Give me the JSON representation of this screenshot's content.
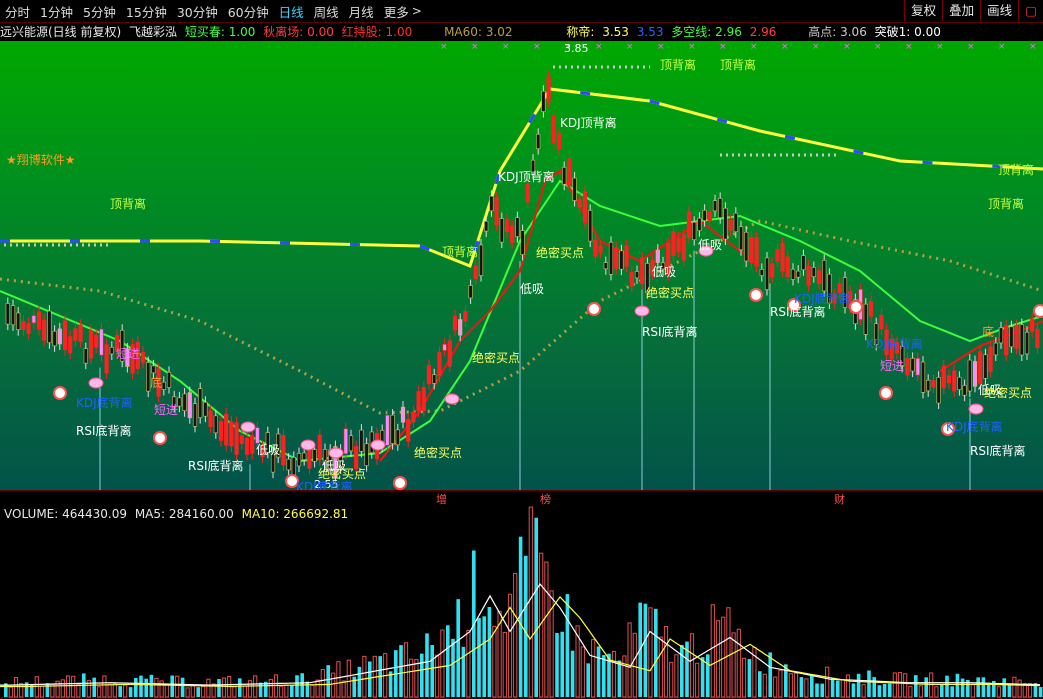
{
  "toolbar": {
    "periods": [
      "分时",
      "1分钟",
      "5分钟",
      "15分钟",
      "30分钟",
      "60分钟",
      "日线",
      "周线",
      "月线",
      "更多"
    ],
    "active_period": "日线",
    "buttons": [
      "复权",
      "叠加",
      "画线"
    ]
  },
  "info_bar": {
    "stock_title": "远兴能源(日线 前复权)",
    "indicator_name": "飞越彩泓",
    "short_buy": "短买春: 1.00",
    "autumn": "秋离场: 0.00",
    "red_hold": "红持股: 1.00",
    "ma60": "MA60: 3.02",
    "chengdi_label": "称帝:",
    "chengdi_value1": "3.53",
    "chengdi_value2": "3.53",
    "duokong": "多空线: 2.96",
    "duokong_value2": "2.96",
    "high_point": "高点: 3.06",
    "breakthrough": "突破1: 0.00"
  },
  "colors": {
    "up_candle": "#ff2020",
    "down_candle": "#00ffff",
    "ma_yellow": "#ffff40",
    "ma_blue": "#2a4cff",
    "green_line": "#3cff3c",
    "red_line": "#ff1010",
    "dotted_line": "#b8a040",
    "pink_candle": "#ff88ff",
    "label_white": "#ffffff",
    "label_yellow": "#ffff60",
    "label_pink": "#ff66ff",
    "label_blue": "#2060ff",
    "label_orange": "#ff9922",
    "volume_red": "#e05050",
    "volume_cyan": "#30e0f0"
  },
  "main_chart": {
    "price_peak_label": "3.85",
    "price_low_label": "2.55",
    "watermark": "★翔博软件★",
    "annotations": [
      {
        "text": "顶背离",
        "color": "yellow-green"
      },
      {
        "text": "顶背离",
        "color": "yellow-green"
      },
      {
        "text": "顶背离",
        "color": "yellow-green"
      },
      {
        "text": "顶背离",
        "color": "yellow-green"
      },
      {
        "text": "顶背离",
        "color": "yellow-green"
      },
      {
        "text": "顶背离",
        "color": "yellow-green"
      },
      {
        "text": "KDJ顶背离",
        "color": "white"
      },
      {
        "text": "KDJ顶背离",
        "color": "white"
      },
      {
        "text": "低吸",
        "color": "white"
      },
      {
        "text": "低吸",
        "color": "white"
      },
      {
        "text": "低吸",
        "color": "white"
      },
      {
        "text": "低吸",
        "color": "white"
      },
      {
        "text": "低吸",
        "color": "white"
      },
      {
        "text": "低吸",
        "color": "white"
      },
      {
        "text": "绝密买点",
        "color": "yellow"
      },
      {
        "text": "绝密买点",
        "color": "yellow"
      },
      {
        "text": "绝密买点",
        "color": "yellow"
      },
      {
        "text": "绝密买点",
        "color": "yellow"
      },
      {
        "text": "绝密买点",
        "color": "yellow"
      },
      {
        "text": "绝密买点",
        "color": "yellow"
      },
      {
        "text": "RSI底背离",
        "color": "white"
      },
      {
        "text": "RSI底背离",
        "color": "white"
      },
      {
        "text": "RSI底背离",
        "color": "white"
      },
      {
        "text": "RSI底背离",
        "color": "white"
      },
      {
        "text": "RSI底背离",
        "color": "white"
      },
      {
        "text": "KDJ底背离",
        "color": "blue"
      },
      {
        "text": "KDJ底背离",
        "color": "blue"
      },
      {
        "text": "KDJ底背离",
        "color": "blue"
      },
      {
        "text": "KDJ底背离",
        "color": "blue"
      },
      {
        "text": "KDJ底背离",
        "color": "blue"
      },
      {
        "text": "短进",
        "color": "pink"
      },
      {
        "text": "短进",
        "color": "pink"
      },
      {
        "text": "短进",
        "color": "pink"
      },
      {
        "text": "底",
        "color": "orange"
      },
      {
        "text": "底",
        "color": "orange"
      }
    ]
  },
  "date_strip": [
    "增",
    "榜",
    "财"
  ],
  "volume": {
    "volume_label": "VOLUME: 464430.09",
    "ma5_label": "MA5: 284160.00",
    "ma10_label": "MA10: 266692.81"
  }
}
